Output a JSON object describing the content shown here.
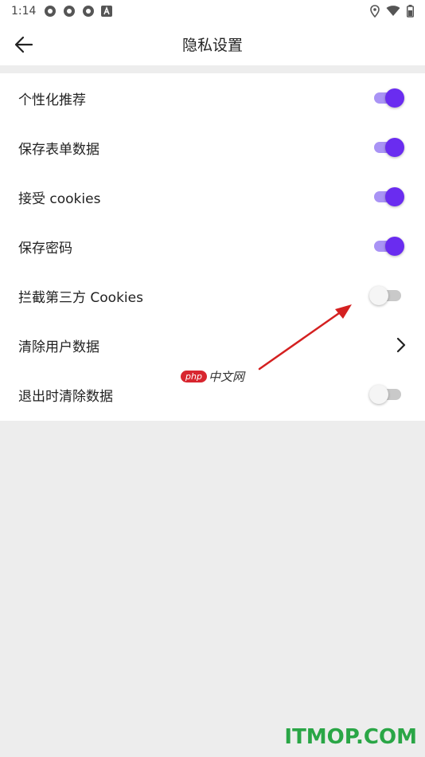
{
  "status_bar": {
    "time": "1:14",
    "left_icons": [
      "app-notification-icon",
      "app-notification-icon",
      "app-notification-icon",
      "a-badge-icon"
    ],
    "right_icons": [
      "location-icon",
      "wifi-icon",
      "battery-icon"
    ]
  },
  "app_bar": {
    "back_icon": "arrow-left-icon",
    "title": "隐私设置"
  },
  "settings": [
    {
      "label": "个性化推荐",
      "control": "switch",
      "on": true
    },
    {
      "label": "保存表单数据",
      "control": "switch",
      "on": true
    },
    {
      "label": "接受 cookies",
      "control": "switch",
      "on": true
    },
    {
      "label": "保存密码",
      "control": "switch",
      "on": true
    },
    {
      "label": "拦截第三方 Cookies",
      "control": "switch",
      "on": false
    },
    {
      "label": "清除用户数据",
      "control": "chevron"
    },
    {
      "label": "退出时清除数据",
      "control": "switch",
      "on": false
    }
  ],
  "watermarks": {
    "php_badge": "php",
    "php_cn": "中文网",
    "site": "ITMOP.COM"
  },
  "colors": {
    "accent": "#6a2cf0",
    "accent_track": "#a993f5",
    "annotation_arrow": "#d42020",
    "site_watermark": "#2aa646"
  }
}
